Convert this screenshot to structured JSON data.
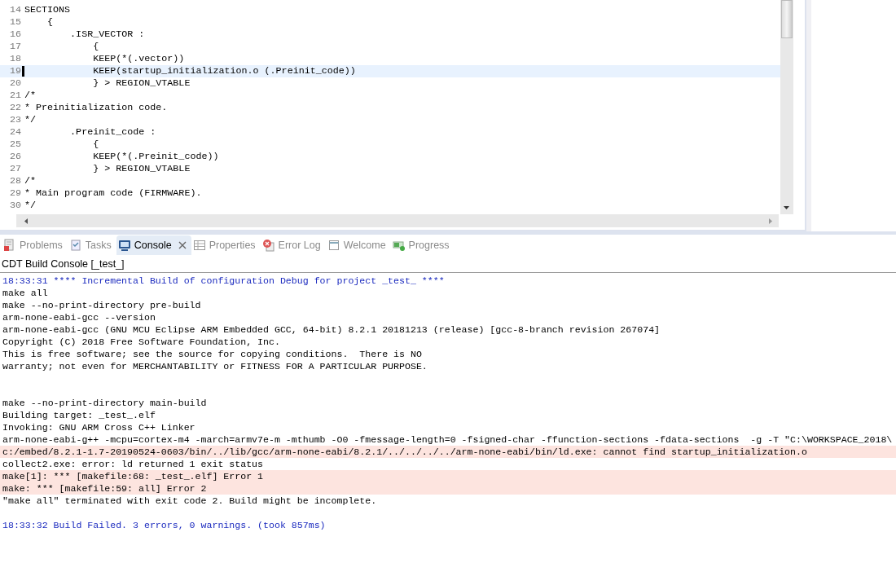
{
  "editor": {
    "lines": [
      {
        "number": "14",
        "code": "SECTIONS",
        "current": false
      },
      {
        "number": "15",
        "code": "    {",
        "current": false
      },
      {
        "number": "16",
        "code": "        .ISR_VECTOR :",
        "current": false
      },
      {
        "number": "17",
        "code": "            {",
        "current": false
      },
      {
        "number": "18",
        "code": "            KEEP(*(.vector))",
        "current": false
      },
      {
        "number": "19",
        "code": "            KEEP(startup_initialization.o (.Preinit_code))",
        "current": true
      },
      {
        "number": "20",
        "code": "            } > REGION_VTABLE",
        "current": false
      },
      {
        "number": "21",
        "code": "/*",
        "current": false
      },
      {
        "number": "22",
        "code": "* Preinitialization code.",
        "current": false
      },
      {
        "number": "23",
        "code": "*/",
        "current": false
      },
      {
        "number": "24",
        "code": "        .Preinit_code :",
        "current": false
      },
      {
        "number": "25",
        "code": "            {",
        "current": false
      },
      {
        "number": "26",
        "code": "            KEEP(*(.Preinit_code))",
        "current": false
      },
      {
        "number": "27",
        "code": "            } > REGION_VTABLE",
        "current": false
      },
      {
        "number": "28",
        "code": "/*",
        "current": false
      },
      {
        "number": "29",
        "code": "* Main program code (FIRMWARE).",
        "current": false
      },
      {
        "number": "30",
        "code": "*/",
        "current": false
      }
    ]
  },
  "tabs": [
    {
      "kind": "problems",
      "label": "Problems",
      "selected": false
    },
    {
      "kind": "tasks",
      "label": "Tasks",
      "selected": false
    },
    {
      "kind": "console",
      "label": "Console",
      "selected": true
    },
    {
      "kind": "properties",
      "label": "Properties",
      "selected": false
    },
    {
      "kind": "errorlog",
      "label": "Error Log",
      "selected": false
    },
    {
      "kind": "welcome",
      "label": "Welcome",
      "selected": false
    },
    {
      "kind": "progress",
      "label": "Progress",
      "selected": false
    }
  ],
  "console": {
    "title": "CDT Build Console [_test_]",
    "lines": [
      {
        "kind": "info",
        "text": "18:33:31 **** Incremental Build of configuration Debug for project _test_ ****"
      },
      {
        "kind": "output",
        "text": "make all"
      },
      {
        "kind": "output",
        "text": "make --no-print-directory pre-build"
      },
      {
        "kind": "output",
        "text": "arm-none-eabi-gcc --version"
      },
      {
        "kind": "output",
        "text": "arm-none-eabi-gcc (GNU MCU Eclipse ARM Embedded GCC, 64-bit) 8.2.1 20181213 (release) [gcc-8-branch revision 267074]"
      },
      {
        "kind": "output",
        "text": "Copyright (C) 2018 Free Software Foundation, Inc."
      },
      {
        "kind": "output",
        "text": "This is free software; see the source for copying conditions.  There is NO"
      },
      {
        "kind": "output",
        "text": "warranty; not even for MERCHANTABILITY or FITNESS FOR A PARTICULAR PURPOSE."
      },
      {
        "kind": "blank"
      },
      {
        "kind": "blank"
      },
      {
        "kind": "output",
        "text": "make --no-print-directory main-build"
      },
      {
        "kind": "output",
        "text": "Building target: _test_.elf"
      },
      {
        "kind": "output",
        "text": "Invoking: GNU ARM Cross C++ Linker"
      },
      {
        "kind": "output",
        "text": "arm-none-eabi-g++ -mcpu=cortex-m4 -march=armv7e-m -mthumb -O0 -fmessage-length=0 -fsigned-char -ffunction-sections -fdata-sections  -g -T \"C:\\WORKSPACE_2018\\"
      },
      {
        "kind": "error",
        "text": "c:/embed/8.2.1-1.7-20190524-0603/bin/../lib/gcc/arm-none-eabi/8.2.1/../../../../arm-none-eabi/bin/ld.exe: cannot find startup_initialization.o"
      },
      {
        "kind": "output",
        "text": "collect2.exe: error: ld returned 1 exit status"
      },
      {
        "kind": "error",
        "text": "make[1]: *** [makefile:68: _test_.elf] Error 1"
      },
      {
        "kind": "error",
        "text": "make: *** [makefile:59: all] Error 2"
      },
      {
        "kind": "output",
        "text": "\"make all\" terminated with exit code 2. Build might be incomplete."
      },
      {
        "kind": "blank"
      },
      {
        "kind": "info",
        "text": "18:33:32 Build Failed. 3 errors, 0 warnings. (took 857ms)"
      }
    ]
  }
}
